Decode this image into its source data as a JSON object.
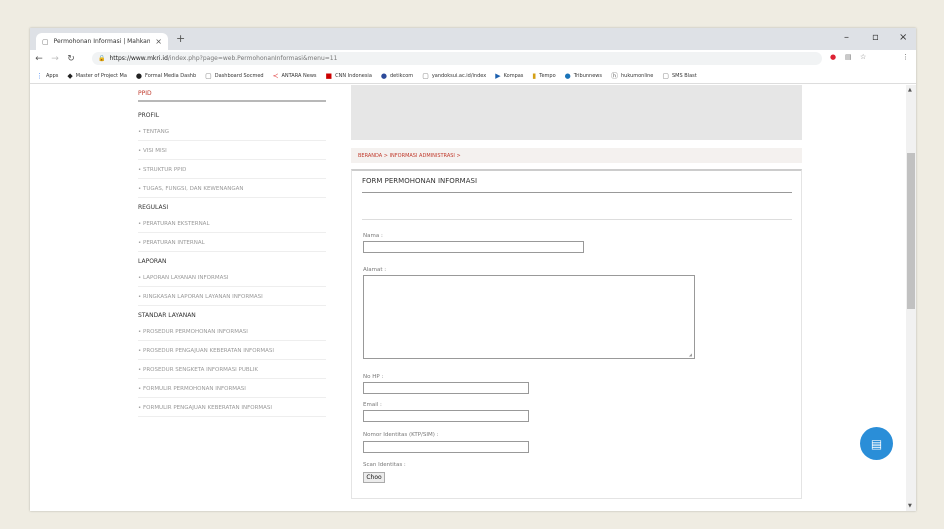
{
  "browser": {
    "tab_title": "Permohonan Informasi | Mahkam",
    "url_host": "https://www.mkri.id",
    "url_path": "/index.php?page=web.PermohonanInformasi&menu=11",
    "bookmarks": [
      "Apps",
      "Master of Project Ma",
      "Formal Media Dashb",
      "Dashboard Socmed",
      "ANTARA News",
      "CNN Indonesia",
      "detikcom",
      "yandoksui.ac.id/index",
      "Kompas",
      "Tempo",
      "Tribunnews",
      "hukumonline",
      "SMS Blast"
    ]
  },
  "sidebar": {
    "header": "PPID",
    "sections": [
      {
        "title": "PROFIL",
        "items": [
          "TENTANG",
          "VISI MISI",
          "STRUKTUR PPID",
          "TUGAS, FUNGSI, DAN KEWENANGAN"
        ]
      },
      {
        "title": "REGULASI",
        "items": [
          "PERATURAN EKSTERNAL",
          "PERATURAN INTERNAL"
        ]
      },
      {
        "title": "LAPORAN",
        "items": [
          "LAPORAN LAYANAN INFORMASI",
          "RINGKASAN LAPORAN LAYANAN INFORMASI"
        ]
      },
      {
        "title": "STANDAR LAYANAN",
        "items": [
          "PROSEDUR PERMOHONAN INFORMASI",
          "PROSEDUR PENGAJUAN KEBERATAN INFORMASI",
          "PROSEDUR SENGKETA INFORMASI PUBLIK",
          "FORMULIR PERMOHONAN INFORMASI",
          "FORMULIR PENGAJUAN KEBERATAN INFORMASI"
        ]
      }
    ]
  },
  "main": {
    "breadcrumb": "BERANDA > INFORMASI ADMINISTRASI >",
    "form_title": "FORM PERMOHONAN INFORMASI",
    "fields": {
      "nama": "Nama :",
      "alamat": "Alamat :",
      "no_hp": "No HP :",
      "email": "Email :",
      "nomor_identitas": "Nomor Identitas (KTP/SIM) :",
      "scan_identitas": "Scan Identitas :"
    },
    "file_button": "Choo"
  }
}
